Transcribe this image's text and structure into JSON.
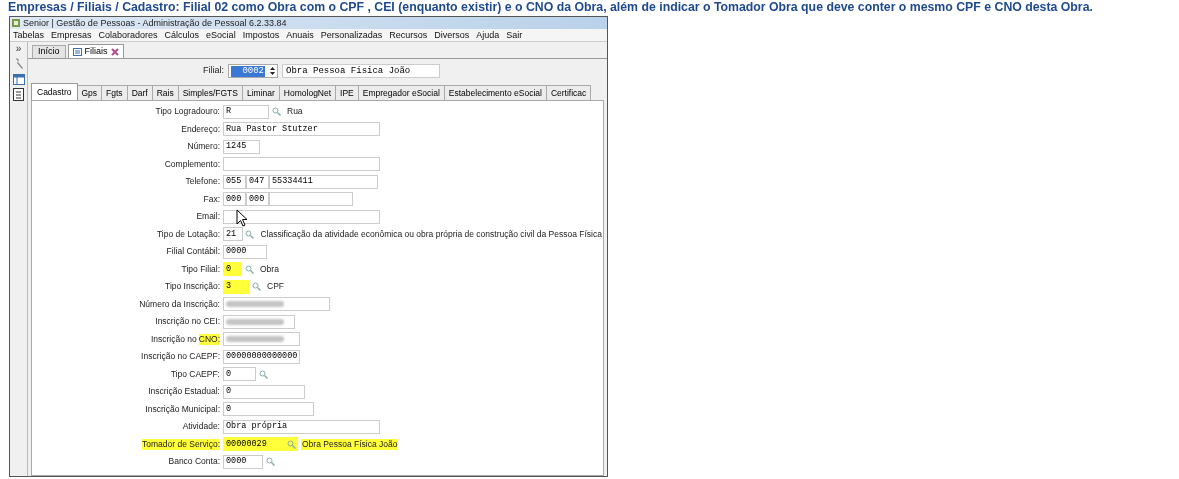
{
  "caption": "Empresas / Filiais / Cadastro: Filial 02 como Obra com o CPF , CEI (enquanto existir) e o CNO da Obra, além de indicar o Tomador Obra que deve conter o mesmo CPF e CNO desta Obra.",
  "window": {
    "title": "Senior | Gestão de Pessoas - Administração de Pessoal 6.2.33.84"
  },
  "menu": [
    "Tabelas",
    "Empresas",
    "Colaboradores",
    "Cálculos",
    "eSocial",
    "Impostos",
    "Anuais",
    "Personalizadas",
    "Recursos",
    "Diversos",
    "Ajuda",
    "Sair"
  ],
  "sidebar": {
    "expand": "»"
  },
  "tabs": [
    {
      "label": "Início",
      "selected": false,
      "closable": false
    },
    {
      "label": "Filiais",
      "selected": true,
      "closable": true
    }
  ],
  "filial": {
    "label": "Filial:",
    "code": "0002",
    "name": "Obra Pessoa Fisica João"
  },
  "subtabs": [
    {
      "label": "Cadastro",
      "selected": true
    },
    {
      "label": "Gps",
      "selected": false
    },
    {
      "label": "Fgts",
      "selected": false
    },
    {
      "label": "Darf",
      "selected": false
    },
    {
      "label": "Rais",
      "selected": false
    },
    {
      "label": "Simples/FGTS",
      "selected": false
    },
    {
      "label": "Liminar",
      "selected": false
    },
    {
      "label": "HomologNet",
      "selected": false
    },
    {
      "label": "IPE",
      "selected": false
    },
    {
      "label": "Empregador eSocial",
      "selected": false
    },
    {
      "label": "Estabelecimento eSocial",
      "selected": false
    },
    {
      "label": "Certificac",
      "selected": false
    }
  ],
  "form": [
    {
      "label": [
        {
          "text": "Tipo Logradouro:",
          "highlighted": false
        }
      ],
      "fields": [
        {
          "kind": "text",
          "value": "R",
          "highlighted": false
        }
      ],
      "lookup": {
        "highlighted": false
      },
      "description": {
        "text": "Rua",
        "highlighted": false
      }
    },
    {
      "label": [
        {
          "text": "Endereço:",
          "highlighted": false
        }
      ],
      "fields": [
        {
          "kind": "text",
          "value": "Rua Pastor Stutzer",
          "highlighted": false
        }
      ]
    },
    {
      "label": [
        {
          "text": "Número:",
          "highlighted": false
        }
      ],
      "fields": [
        {
          "kind": "text",
          "value": "1245",
          "highlighted": false
        }
      ]
    },
    {
      "label": [
        {
          "text": "Complemento:",
          "highlighted": false
        }
      ],
      "fields": [
        {
          "kind": "text",
          "highlighted": false
        }
      ]
    },
    {
      "label": [
        {
          "text": "Telefone:",
          "highlighted": false
        }
      ],
      "fields": [
        {
          "kind": "text",
          "value": "055",
          "highlighted": false
        },
        {
          "kind": "text",
          "value": "047",
          "highlighted": false
        },
        {
          "kind": "text",
          "value": "55334411",
          "highlighted": false
        }
      ]
    },
    {
      "label": [
        {
          "text": "Fax:",
          "highlighted": false
        }
      ],
      "fields": [
        {
          "kind": "text",
          "value": "000",
          "highlighted": false
        },
        {
          "kind": "text",
          "value": "000",
          "highlighted": false
        },
        {
          "kind": "text",
          "highlighted": false
        }
      ]
    },
    {
      "label": [
        {
          "text": "Email:",
          "highlighted": false
        }
      ],
      "fields": [
        {
          "kind": "text",
          "highlighted": false
        }
      ]
    },
    {
      "label": [
        {
          "text": "Tipo de Lotação:",
          "highlighted": false
        }
      ],
      "fields": [
        {
          "kind": "text",
          "value": "21",
          "highlighted": false
        }
      ],
      "lookup": {
        "highlighted": false
      },
      "description": {
        "text": "Classificação da atividade econômica ou obra própria de construção civil da Pessoa Física",
        "highlighted": false
      }
    },
    {
      "label": [
        {
          "text": "Filial Contábil:",
          "highlighted": false
        }
      ],
      "fields": [
        {
          "kind": "text",
          "value": "0000",
          "highlighted": false
        }
      ]
    },
    {
      "label": [
        {
          "text": "Tipo Filial:",
          "highlighted": false
        }
      ],
      "fields": [
        {
          "kind": "text",
          "value": "0",
          "highlighted": true
        }
      ],
      "lookup": {
        "highlighted": false
      },
      "description": {
        "text": "Obra",
        "highlighted": false
      }
    },
    {
      "label": [
        {
          "text": "Tipo Inscrição:",
          "highlighted": false
        }
      ],
      "fields": [
        {
          "kind": "text",
          "value": "3",
          "highlighted": true
        }
      ],
      "lookup": {
        "highlighted": false
      },
      "description": {
        "text": "CPF",
        "highlighted": false
      }
    },
    {
      "label": [
        {
          "text": "Número da Inscrição:",
          "highlighted": false
        }
      ],
      "fields": [
        {
          "kind": "blurred",
          "highlighted": false
        }
      ]
    },
    {
      "label": [
        {
          "text": "Inscrição no CEI:",
          "highlighted": false
        }
      ],
      "fields": [
        {
          "kind": "blurred",
          "highlighted": false
        }
      ]
    },
    {
      "label": [
        {
          "text": "Inscrição no",
          "highlighted": false
        },
        {
          "text": "CNO:",
          "highlighted": true
        }
      ],
      "fields": [
        {
          "kind": "blurred",
          "highlighted": false
        }
      ]
    },
    {
      "label": [
        {
          "text": "Inscrição no CAEPF:",
          "highlighted": false
        }
      ],
      "fields": [
        {
          "kind": "text",
          "value": "00000000000000",
          "highlighted": false
        }
      ]
    },
    {
      "label": [
        {
          "text": "Tipo CAEPF:",
          "highlighted": false
        }
      ],
      "fields": [
        {
          "kind": "text",
          "value": "0",
          "highlighted": false
        }
      ],
      "lookup": {
        "highlighted": false
      }
    },
    {
      "label": [
        {
          "text": "Inscrição Estadual:",
          "highlighted": false
        }
      ],
      "fields": [
        {
          "kind": "text",
          "value": "0",
          "highlighted": false
        }
      ]
    },
    {
      "label": [
        {
          "text": "Inscrição Municipal:",
          "highlighted": false
        }
      ],
      "fields": [
        {
          "kind": "text",
          "value": "0",
          "highlighted": false
        }
      ]
    },
    {
      "label": [
        {
          "text": "Atividade:",
          "highlighted": false
        }
      ],
      "fields": [
        {
          "kind": "text",
          "value": "Obra própria",
          "highlighted": false
        }
      ]
    },
    {
      "label": [
        {
          "text": "Tomador de Serviço:",
          "highlighted": true
        }
      ],
      "fields": [
        {
          "kind": "text",
          "value": "00000029",
          "highlighted": true
        }
      ],
      "lookup": {
        "highlighted": true
      },
      "description": {
        "text": "Obra Pessoa Física João",
        "highlighted": true
      }
    },
    {
      "label": [
        {
          "text": "Banco Conta:",
          "highlighted": false
        }
      ],
      "fields": [
        {
          "kind": "text",
          "value": "0000",
          "highlighted": false
        }
      ],
      "lookup": {
        "highlighted": false
      }
    }
  ]
}
